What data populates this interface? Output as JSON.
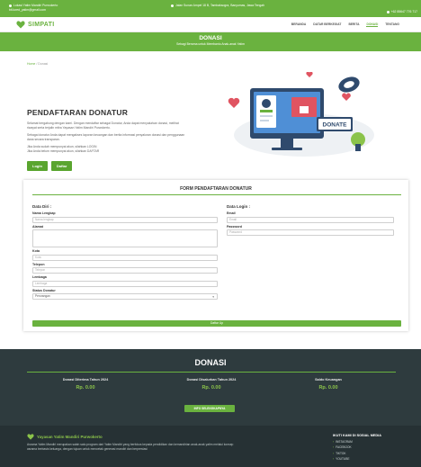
{
  "topbar": {
    "line1": "Lokasi Yatim Mandiri Purwokerto",
    "email": "bit.lured_yatim@gmail.com",
    "address": "Jalan Sunan Ampel 18 B, Tambaksogra, Banyumas, Jawa Tengah",
    "phone": "+62 85647 776 717"
  },
  "brand": {
    "name": "SIMPATI"
  },
  "menu": [
    "BERANDA",
    "DATAR BERKEGIAT",
    "BERITA",
    "DONASI",
    "TENTANG"
  ],
  "menu_active": "DONASI",
  "hero": {
    "title": "DONASI",
    "subtitle": "Sebagi Berama untuk Membantu Anak-anak Yatim"
  },
  "breadcrumb": {
    "home": "Home",
    "sep": "/",
    "current": "Donasi"
  },
  "intro": {
    "title": "PENDAFTARAN DONATUR",
    "p1": "Selamat bergabung dengan kami. Dengan mendaftar sebagai Donatur, Anda dapat menyalurkan donasi, melihat riwayat serta terjalin mitra Yayasan Yatim Mandiri Purwokerto.",
    "p2": "Sebagai donatur Anda dapat mengakses laporan keuangan dan berita informasi penyaluran donasi dan penggunaan dana secara transparan.",
    "p3": "Jika Anda sudah mempunyai akun, silahkan LOGIN",
    "p4": "Jika Anda belum mempunyai akun, silahkan DAFTAR",
    "login": "Login",
    "daftar": "Daftar"
  },
  "illustration": {
    "donate_text": "DONATE"
  },
  "form": {
    "title": "FORM PENDAFTARAN DONATUR",
    "data_diri": "Data Diri :",
    "data_login": "Data Login :",
    "nama_label": "Nama Lengkap",
    "nama_ph": "Nama lengkap",
    "alamat_label": "Alamat",
    "kota_label": "Kota",
    "kota_ph": "Kota",
    "telp_label": "Telepon",
    "telp_ph": "Telepon",
    "lembaga_label": "Lembaga",
    "lembaga_ph": "Lembaga",
    "status_label": "Status Donatur",
    "status_value": "Perorangan",
    "email_label": "Email",
    "email_ph": "Email",
    "password_label": "Password",
    "password_ph": "Password",
    "submit": "Daftar Up"
  },
  "stats": {
    "title": "DONASI",
    "items": [
      {
        "label": "Donasi Diterima Tahun 2024",
        "value": "Rp. 0.00"
      },
      {
        "label": "Donasi Disalurkan Tahun 2024",
        "value": "Rp. 0.00"
      },
      {
        "label": "Saldo Keuangan",
        "value": "Rp. 0.00"
      }
    ],
    "button": "INFO SELENGKAPNYA"
  },
  "footer": {
    "org": "Yayasan Yatim Mandiri Purwokerto",
    "desc": "Asrama Yatim Mandiri merupakan salah satu program dari Yatim Mandiri yang berfokus kepada pendidikan dan kemandirian anak-anak yatim melalui konsep asrama berbasis keluarga, dengan tujuan untuk mencetak generasi mandiri dan berprestasi",
    "social_title": "IKUTI KAMI DI SOSIAL MEDIA",
    "social": [
      "INSTAGRAM",
      "FACEBOOK",
      "TIKTOK",
      "YOUTUBE"
    ]
  },
  "colors": {
    "primary": "#6ab23f",
    "dark": "#2e3b3e",
    "darker": "#263134"
  }
}
